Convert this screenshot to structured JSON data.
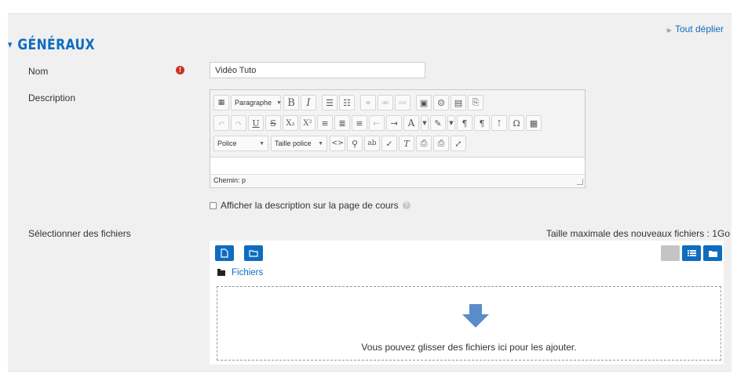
{
  "expand_all": "Tout déplier",
  "section": {
    "title": "GÉNÉRAUX"
  },
  "fields": {
    "name": {
      "label": "Nom",
      "value": "Vidéo Tuto"
    },
    "description": {
      "label": "Description",
      "toolbar": {
        "paragraph": "Paragraphe",
        "font": "Police",
        "font_size": "Taille police"
      },
      "path": "Chemin: p"
    },
    "show_description": {
      "label": "Afficher la description sur la page de cours"
    },
    "files": {
      "label": "Sélectionner des fichiers",
      "max_size": "Taille maximale des nouveaux fichiers : 1Go",
      "breadcrumb": "Fichiers",
      "drop_text": "Vous pouvez glisser des fichiers ici pour les ajouter."
    }
  },
  "colors": {
    "accent": "#0f6cbf",
    "required": "#ca3120"
  }
}
